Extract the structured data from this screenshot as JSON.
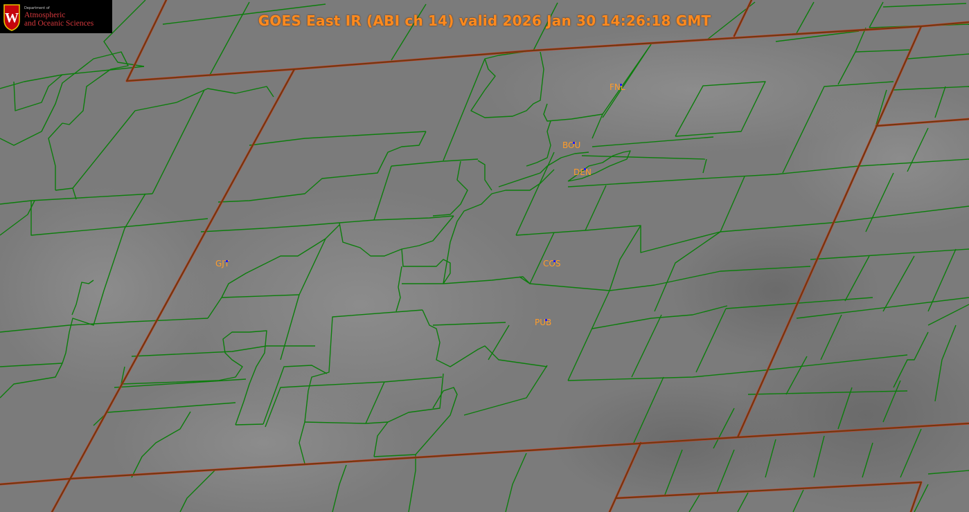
{
  "title": "GOES East IR (ABI ch 14) valid 2026 Jan 30 14:26:18 GMT",
  "logo": {
    "department_small": "Department of",
    "line1": "Atmospheric",
    "line2": "and Oceanic Sciences",
    "crest_letter": "W"
  },
  "stations": [
    {
      "id": "FNL",
      "label": "FNL"
    },
    {
      "id": "BOU",
      "label": "BOU"
    },
    {
      "id": "DEN",
      "label": "DEN"
    },
    {
      "id": "GJT",
      "label": "GJT"
    },
    {
      "id": "COS",
      "label": "COS"
    },
    {
      "id": "PUB",
      "label": "PUB"
    }
  ],
  "colors": {
    "state_border": "#6b3a10",
    "state_border_edge": "#d9301c",
    "county_border": "#0c7d0c",
    "station_label": "#ff9c2a",
    "station_dot": "#1a1aff",
    "title": "#ff8a1e"
  }
}
